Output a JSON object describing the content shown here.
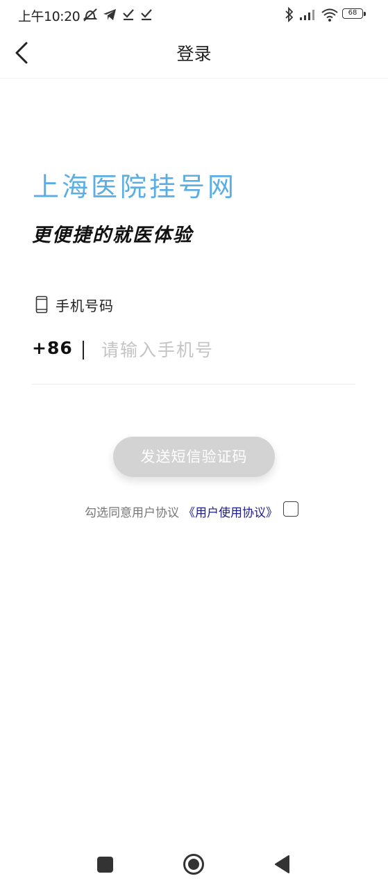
{
  "status_bar": {
    "time": "上午10:20",
    "battery": "68",
    "icons": [
      "mute-icon",
      "telegram-icon",
      "check-icon",
      "check-icon",
      "bluetooth-icon",
      "signal-icon",
      "wifi-icon",
      "battery-icon"
    ]
  },
  "header": {
    "back_icon": "chevron-left-icon",
    "title": "登录"
  },
  "brand": {
    "title": "上海医院挂号网",
    "slogan": "更便捷的就医体验",
    "accent_color": "#5aaee4"
  },
  "phone_section": {
    "icon": "phone-icon",
    "label": "手机号码",
    "country_code": "+86",
    "input_value": "",
    "input_placeholder": "请输入手机号"
  },
  "send_button": {
    "label": "发送短信验证码",
    "state": "disabled"
  },
  "agreement": {
    "text": "勾选同意用户协议",
    "link": "《用户使用协议》",
    "checked": false
  },
  "nav_bar": {
    "items": [
      "recent-apps-icon",
      "home-icon",
      "back-icon"
    ]
  }
}
